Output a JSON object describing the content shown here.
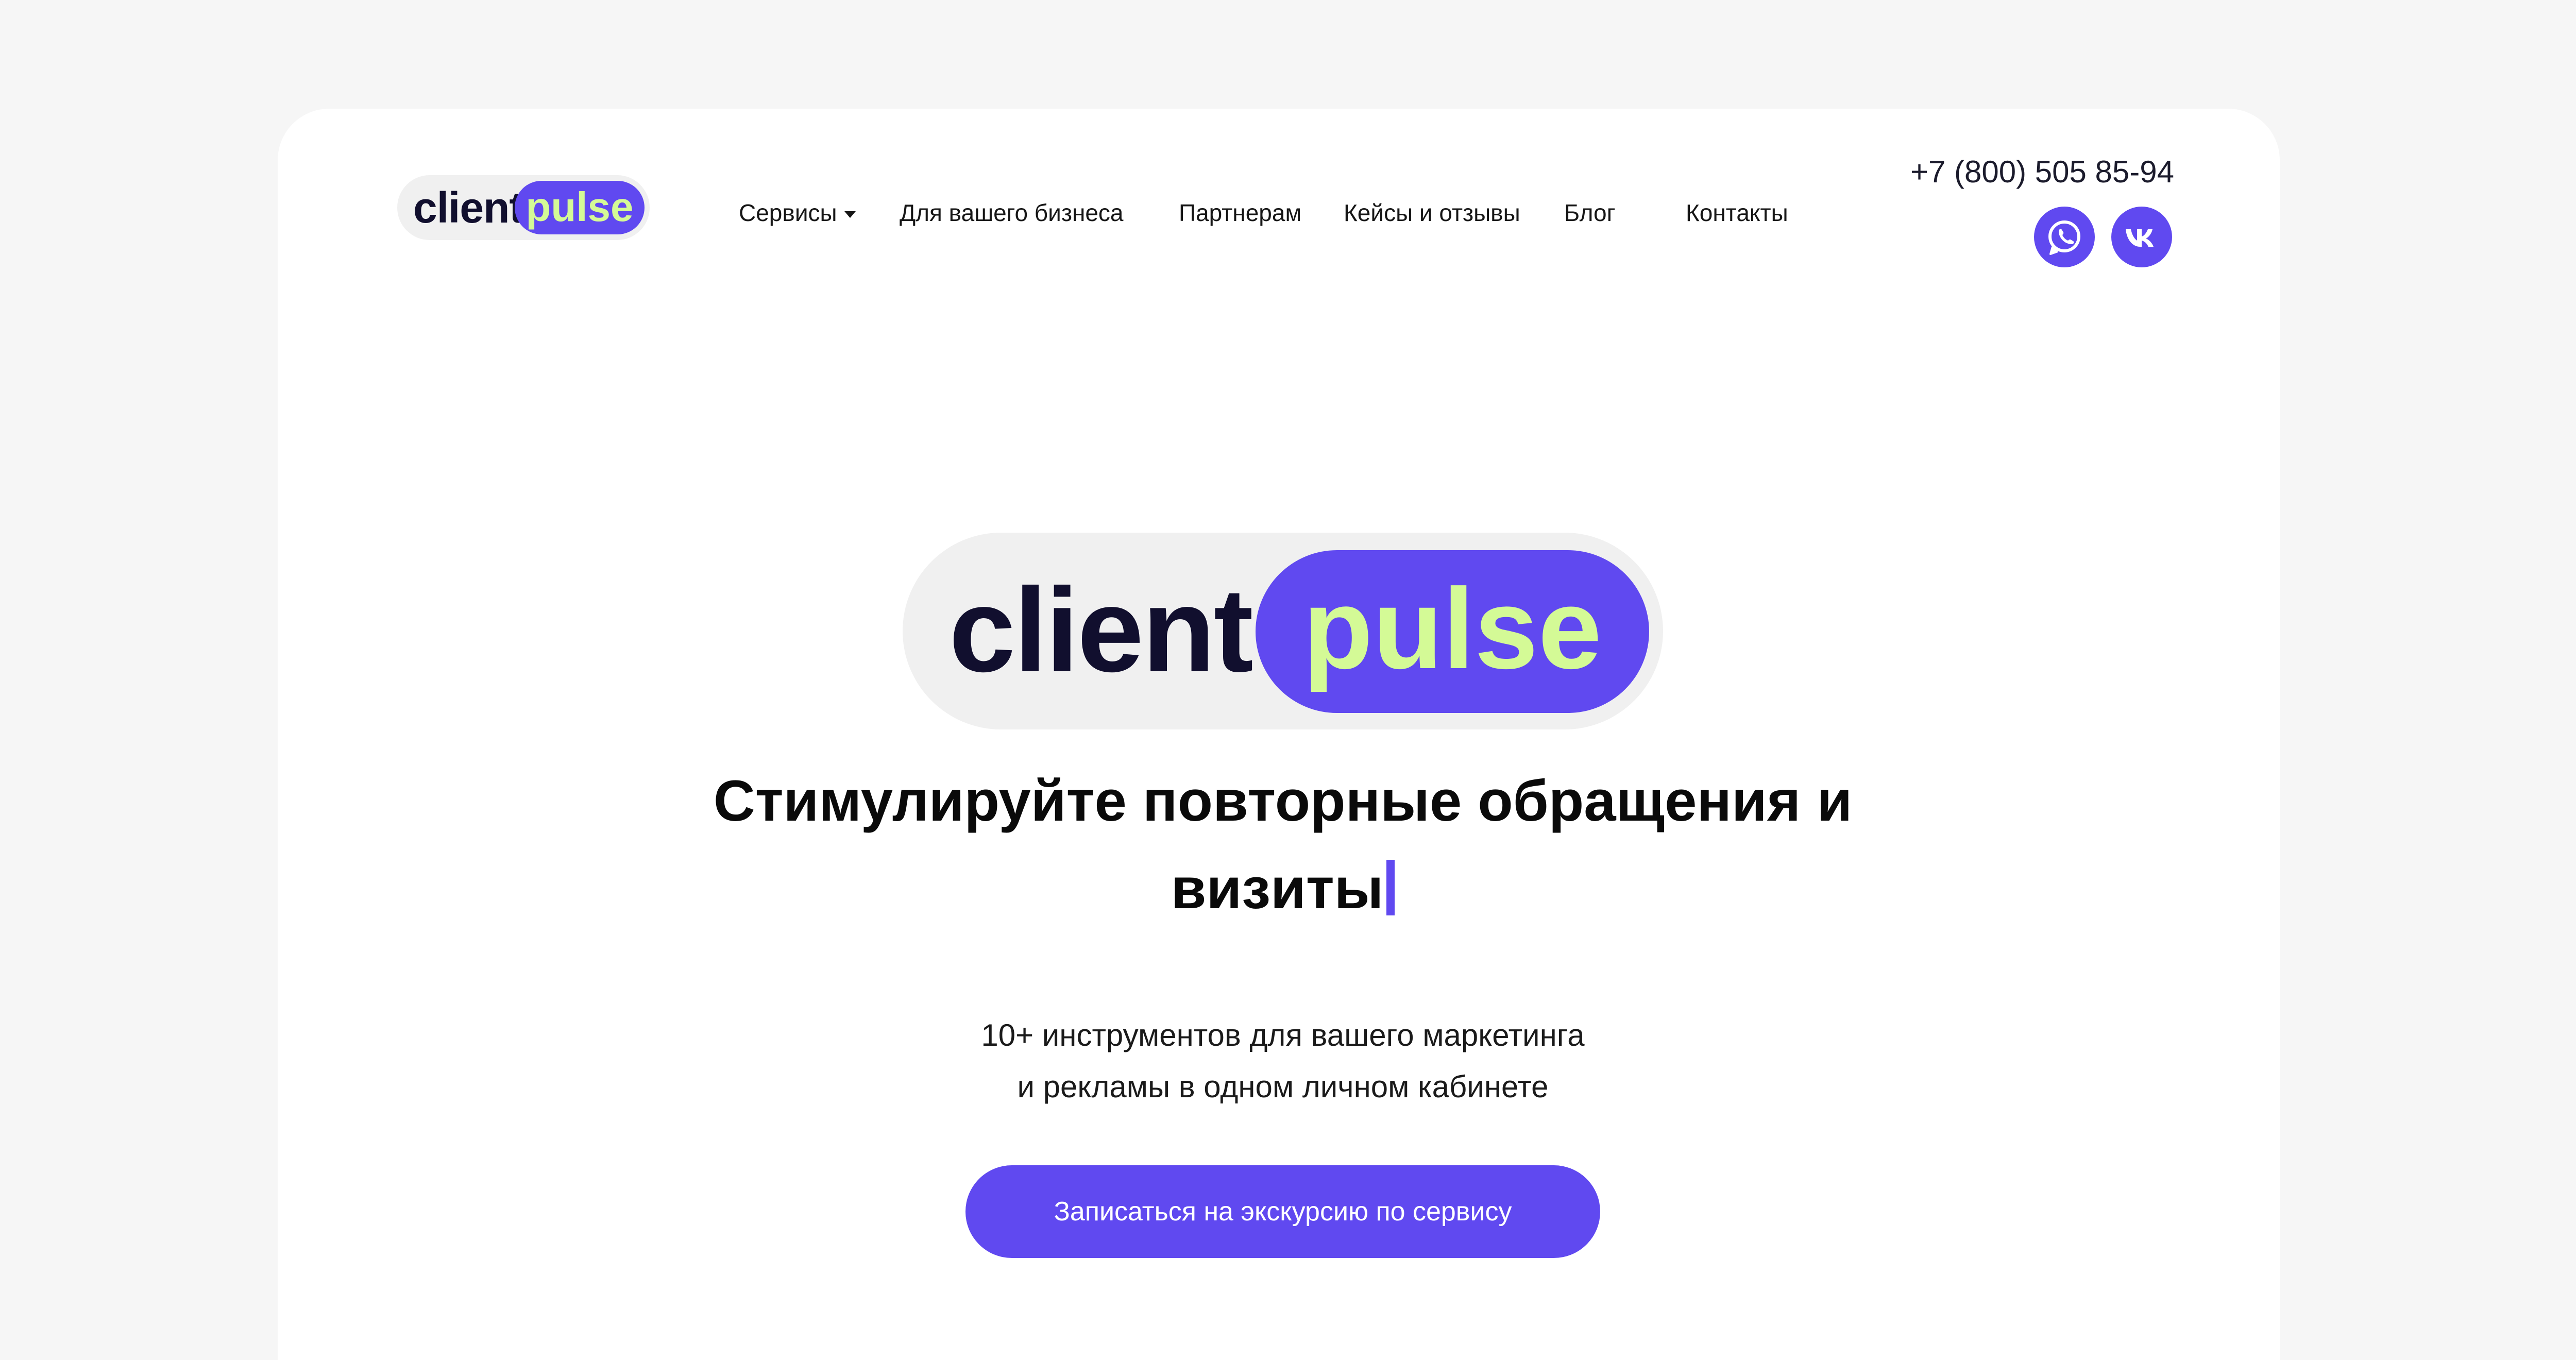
{
  "brand": {
    "name_part1": "client",
    "name_part2": "pulse",
    "colors": {
      "accent": "#6049f0",
      "lime": "#d4fa96",
      "dark": "#110f2e",
      "pill_bg": "#f0f0f0",
      "page_bg": "#f6f6f6"
    }
  },
  "nav": {
    "items": [
      {
        "label": "Сервисы",
        "has_dropdown": true
      },
      {
        "label": "Для вашего бизнеса"
      },
      {
        "label": "Партнерам"
      },
      {
        "label": "Кейсы и отзывы"
      },
      {
        "label": "Блог"
      },
      {
        "label": "Контакты"
      }
    ]
  },
  "contact": {
    "phone": "+7 (800) 505 85-94",
    "social": [
      {
        "icon": "whatsapp-icon"
      },
      {
        "icon": "vk-icon"
      }
    ]
  },
  "hero": {
    "headline_line1": "Стимулируйте повторные обращения и",
    "headline_line2": "визиты",
    "subtext_line1": "10+ инструментов для вашего маркетинга",
    "subtext_line2": "и рекламы в одном личном кабинете",
    "cta_label": "Записаться на экскурсию по сервису"
  }
}
